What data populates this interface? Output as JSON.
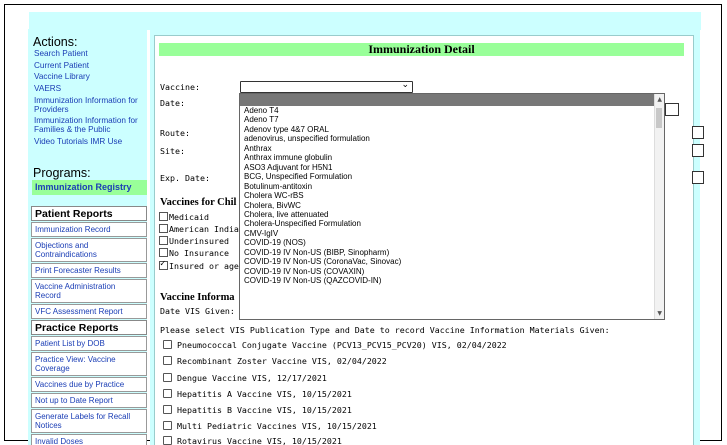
{
  "sidebar": {
    "actions_title": "Actions:",
    "actions": [
      "Search Patient",
      "Current Patient",
      "Vaccine Library",
      "VAERS",
      "Immunization Information for Providers",
      "Immunization Information for Families & the Public",
      "Video Tutorials IMR Use"
    ],
    "programs_title": "Programs:",
    "program_item": "Immunization Registry",
    "patient_reports_header": "Patient Reports",
    "patient_reports": [
      "Immunization Record",
      "Objections and Contraindications",
      "Print Forecaster Results",
      "Vaccine Administration Record",
      "VFC Assessment Report"
    ],
    "practice_reports_header": "Practice Reports",
    "practice_reports": [
      "Patient List by DOB",
      "Practice View: Vaccine Coverage",
      "Vaccines due by Practice",
      "Not up to Date Report",
      "Generate Labels for Recall Notices",
      "Invalid Doses"
    ]
  },
  "main": {
    "title": "Immunization Detail",
    "vaccine_label": "Vaccine:",
    "date_label": "Date:",
    "route_label": "Route:",
    "site_label": "Site:",
    "exp_date_label": "Exp. Date:",
    "vaccines_for_children_label": "Vaccines for Chil",
    "eligibility": [
      {
        "label": "Medicaid",
        "checked": false
      },
      {
        "label": "American Indian",
        "checked": false
      },
      {
        "label": "Underinsured",
        "checked": false
      },
      {
        "label": "No Insurance",
        "checked": false
      },
      {
        "label": "Insured or age",
        "checked": true
      }
    ],
    "vaccine_info_label": "Vaccine Informa",
    "date_vis_given_label": "Date VIS Given:",
    "vis_prompt": "Please select VIS Publication Type and Date to record Vaccine Information Materials Given:",
    "vis_options": [
      "Pneumococcal Conjugate Vaccine (PCV13_PCV15_PCV20) VIS, 02/04/2022",
      "Recombinant Zoster Vaccine VIS, 02/04/2022",
      "Dengue Vaccine VIS, 12/17/2021",
      "Hepatitis A Vaccine VIS, 10/15/2021",
      "Hepatitis B Vaccine VIS, 10/15/2021",
      "Multi Pediatric Vaccines VIS, 10/15/2021",
      "Rotavirus Vaccine VIS, 10/15/2021"
    ]
  },
  "vaccine_dropdown": {
    "selected_value": "",
    "options": [
      "Adeno T4",
      "Adeno T7",
      "Adenov type 4&7 ORAL",
      "adenovirus, unspecified formulation",
      "Anthrax",
      "Anthrax immune globulin",
      "ASO3 Adjuvant for H5N1",
      "BCG, Unspecified Formulation",
      "Botulinum-antitoxin",
      "Cholera WC-rBS",
      "Cholera, BivWC",
      "Cholera, live attenuated",
      "Cholera-Unspecified Formulation",
      "CMV-IgIV",
      "COVID-19 (NOS)",
      "COVID-19 IV Non-US (BIBP, Sinopharm)",
      "COVID-19 IV Non-US (CoronaVac, Sinovac)",
      "COVID-19 IV Non-US (COVAXIN)",
      "COVID-19 IV Non-US (QAZCOVID-IN)"
    ]
  },
  "colors": {
    "page_background": "#ccffff",
    "header_green": "#99ff99",
    "link_blue": "#1a3db5",
    "dropdown_highlight": "#777777"
  }
}
